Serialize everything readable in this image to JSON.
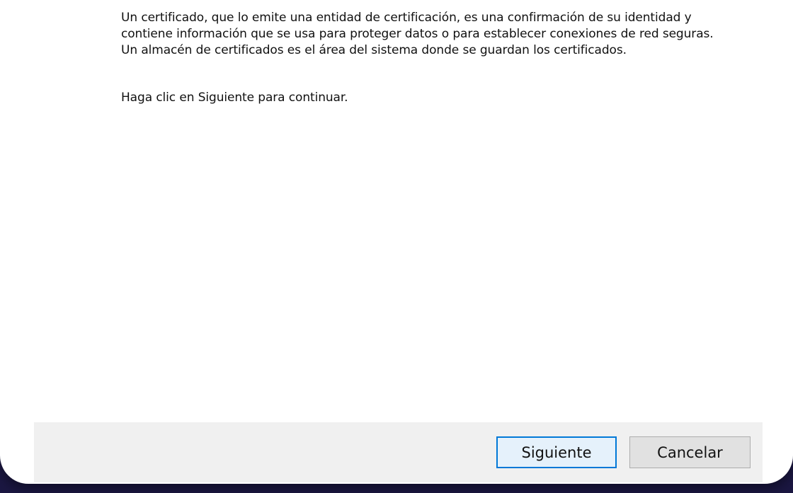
{
  "dialog": {
    "description": "Un certificado, que lo emite una entidad de certificación, es una confirmación de su identidad y contiene información que se usa para proteger datos o para establecer conexiones de red seguras. Un almacén de certificados es el área del sistema donde se guardan los certificados.",
    "instruction": "Haga clic en Siguiente para continuar."
  },
  "buttons": {
    "next_label": "Siguiente",
    "cancel_label": "Cancelar"
  },
  "colors": {
    "backdrop": "#241f55",
    "dialog_background": "#ffffff",
    "footer_background": "#f0f0f0",
    "default_button_border": "#0078d7"
  }
}
